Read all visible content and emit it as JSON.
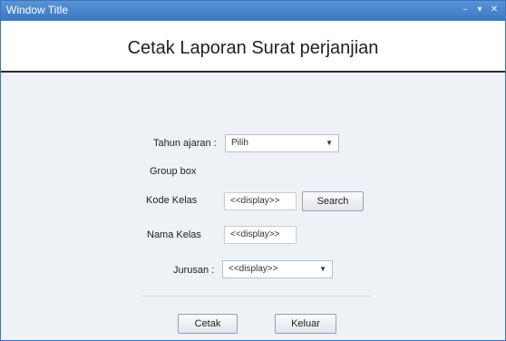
{
  "window": {
    "title": "Window Title",
    "controls": [
      "minimize-icon",
      "maximize-icon",
      "close-icon"
    ]
  },
  "header": {
    "heading": "Cetak Laporan Surat perjanjian"
  },
  "form": {
    "tahun_ajaran": {
      "label": "Tahun ajaran :",
      "selected": "Pilih"
    },
    "group_box": {
      "label": "Group box"
    },
    "kode_kelas": {
      "label": "Kode Kelas",
      "value": "<<display>>"
    },
    "search_label": "Search",
    "nama_kelas": {
      "label": "Nama Kelas",
      "value": "<<display>>"
    },
    "jurusan": {
      "label": "Jurusan :",
      "selected": "<<display>>"
    }
  },
  "actions": {
    "cetak_label": "Cetak",
    "keluar_label": "Keluar"
  },
  "colors": {
    "titlebar": "#3a78c4",
    "background": "#eef1f5",
    "header_rule": "#2b2b2b"
  }
}
